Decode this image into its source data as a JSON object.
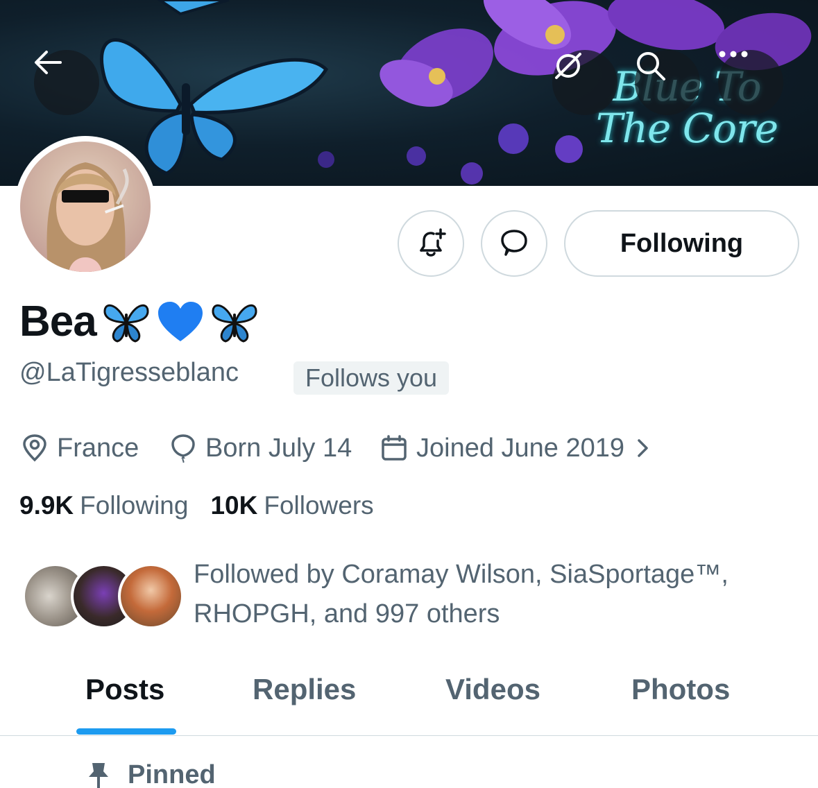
{
  "banner": {
    "text_line1": "Blue To",
    "text_line2": "The Core"
  },
  "header_buttons": {
    "back_icon": "arrow-left-icon",
    "grok_icon": "grok-icon",
    "search_icon": "search-icon",
    "more_icon": "more-icon"
  },
  "profile": {
    "display_name": "Bea",
    "name_emojis": [
      "🦋",
      "💙",
      "🦋"
    ],
    "handle": "@LaTigresseblanc",
    "follows_you": "Follows you",
    "following_button": "Following",
    "location": "France",
    "birthday": "Born July 14",
    "joined": "Joined June 2019"
  },
  "stats": {
    "following_count": "9.9K",
    "following_label": "Following",
    "followers_count": "10K",
    "followers_label": "Followers"
  },
  "followed_by": {
    "line1": "Followed by Coramay Wilson, SiaSportage™,",
    "line2": "RHOPGH, and 997 others"
  },
  "tabs": [
    {
      "label": "Posts",
      "active": true
    },
    {
      "label": "Replies",
      "active": false
    },
    {
      "label": "Videos",
      "active": false
    },
    {
      "label": "Photos",
      "active": false
    }
  ],
  "pinned": {
    "label": "Pinned"
  },
  "colors": {
    "accent": "#1d9bf0",
    "text_primary": "#0f1419",
    "text_secondary": "#536471",
    "border": "#cfd9de"
  }
}
